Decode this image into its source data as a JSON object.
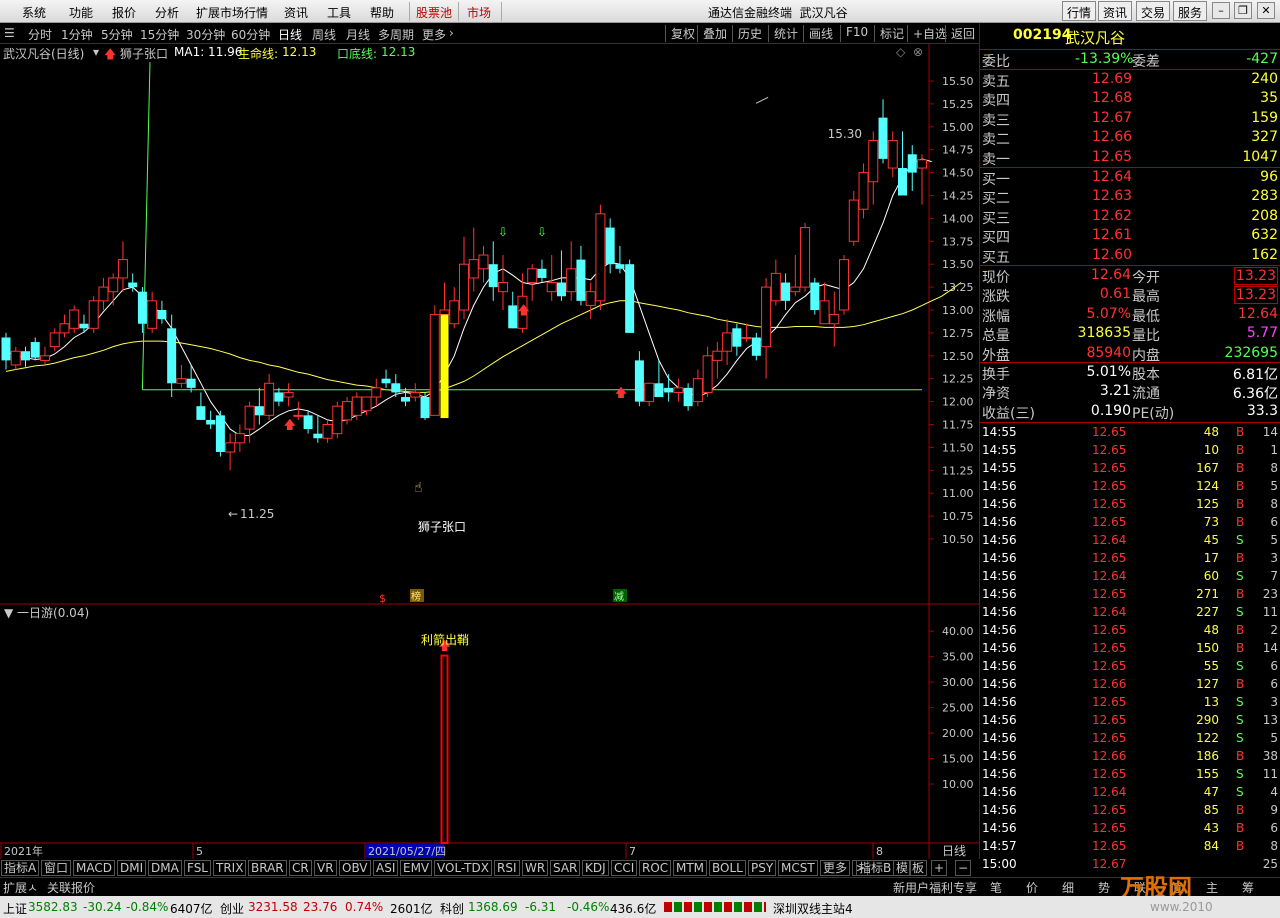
{
  "menu": {
    "items": [
      "系统",
      "功能",
      "报价",
      "分析",
      "扩展市场行情",
      "资讯",
      "工具",
      "帮助"
    ],
    "stock_pool": "股票池",
    "market": "市场",
    "title": "通达信金融终端",
    "stock": "武汉凡谷",
    "right_buttons": [
      "行情",
      "资讯",
      "交易",
      "服务"
    ],
    "window_controls": [
      "minimize-icon",
      "restore-icon",
      "close-icon"
    ]
  },
  "periods": {
    "items": [
      "分时",
      "1分钟",
      "5分钟",
      "15分钟",
      "30分钟",
      "60分钟",
      "日线",
      "周线",
      "月线",
      "多周期",
      "更多"
    ],
    "active": "日线",
    "right": [
      "复权",
      "叠加",
      "历史",
      "统计",
      "画线",
      "F10",
      "标记",
      "+自选",
      "返回"
    ]
  },
  "info": {
    "name": "武汉凡谷(日线)",
    "indicator": "狮子张口",
    "ma1": "MA1: 11.96",
    "life_label": "生命线:",
    "life_value": "12.13",
    "bottom_label": "口底线:",
    "bottom_value": "12.13"
  },
  "chart": {
    "labels": {
      "high": "15.30",
      "low": "11.25",
      "signal": "狮子张口"
    },
    "price_ticks": [
      "15.50",
      "15.25",
      "15.00",
      "14.75",
      "14.50",
      "14.25",
      "14.00",
      "13.75",
      "13.50",
      "13.25",
      "13.00",
      "12.75",
      "12.50",
      "12.25",
      "12.00",
      "11.75",
      "11.50",
      "11.25",
      "11.00",
      "10.75",
      "10.50"
    ],
    "markers": [
      "$",
      "榜",
      "减"
    ],
    "sub_title": "一日游(0.04)",
    "sub_signal": "利箭出鞘",
    "sub_ticks": [
      "40.00",
      "35.00",
      "30.00",
      "25.00",
      "20.00",
      "15.00",
      "10.00"
    ],
    "date_axis": [
      "2021年",
      "5",
      "2021/05/27/四",
      "7",
      "8"
    ],
    "period_tag": "日线",
    "colors": {
      "up": "#ff3232",
      "down": "#54ffff",
      "ma": "#ffffff",
      "life": "#ffff54",
      "bottom": "#54ff54",
      "signal_bar": "#ffff00",
      "sub_bar": "#ff0000"
    }
  },
  "chart_data": {
    "type": "candlestick",
    "title": "",
    "ylim": [
      10.5,
      15.5
    ],
    "sub_ylim": [
      0,
      42
    ],
    "candles": [
      {
        "o": 12.7,
        "h": 12.75,
        "l": 12.35,
        "c": 12.45
      },
      {
        "o": 12.4,
        "h": 12.6,
        "l": 12.35,
        "c": 12.55
      },
      {
        "o": 12.55,
        "h": 12.6,
        "l": 12.38,
        "c": 12.45
      },
      {
        "o": 12.65,
        "h": 12.7,
        "l": 12.45,
        "c": 12.48
      },
      {
        "o": 12.45,
        "h": 12.6,
        "l": 12.4,
        "c": 12.5
      },
      {
        "o": 12.6,
        "h": 12.8,
        "l": 12.55,
        "c": 12.75
      },
      {
        "o": 12.75,
        "h": 12.95,
        "l": 12.7,
        "c": 12.85
      },
      {
        "o": 12.8,
        "h": 13.05,
        "l": 12.75,
        "c": 13.0
      },
      {
        "o": 12.85,
        "h": 12.95,
        "l": 12.75,
        "c": 12.8
      },
      {
        "o": 12.8,
        "h": 13.15,
        "l": 12.75,
        "c": 13.1
      },
      {
        "o": 13.1,
        "h": 13.35,
        "l": 13.0,
        "c": 13.25
      },
      {
        "o": 13.2,
        "h": 13.4,
        "l": 13.05,
        "c": 13.35
      },
      {
        "o": 13.35,
        "h": 13.75,
        "l": 13.2,
        "c": 13.55
      },
      {
        "o": 13.3,
        "h": 13.4,
        "l": 13.2,
        "c": 13.25
      },
      {
        "o": 13.2,
        "h": 13.25,
        "l": 12.75,
        "c": 12.85
      },
      {
        "o": 12.8,
        "h": 13.2,
        "l": 12.75,
        "c": 13.1
      },
      {
        "o": 13.0,
        "h": 13.1,
        "l": 12.85,
        "c": 12.9
      },
      {
        "o": 12.8,
        "h": 12.95,
        "l": 12.05,
        "c": 12.2
      },
      {
        "o": 12.2,
        "h": 12.4,
        "l": 12.15,
        "c": 12.25
      },
      {
        "o": 12.25,
        "h": 12.4,
        "l": 12.1,
        "c": 12.15
      },
      {
        "o": 11.95,
        "h": 12.1,
        "l": 11.8,
        "c": 11.8
      },
      {
        "o": 11.8,
        "h": 11.9,
        "l": 11.7,
        "c": 11.75
      },
      {
        "o": 11.85,
        "h": 11.9,
        "l": 11.4,
        "c": 11.45
      },
      {
        "o": 11.45,
        "h": 11.65,
        "l": 11.25,
        "c": 11.55
      },
      {
        "o": 11.55,
        "h": 11.75,
        "l": 11.45,
        "c": 11.65
      },
      {
        "o": 11.7,
        "h": 12.0,
        "l": 11.55,
        "c": 11.95
      },
      {
        "o": 11.95,
        "h": 12.15,
        "l": 11.75,
        "c": 11.85
      },
      {
        "o": 11.85,
        "h": 12.3,
        "l": 11.8,
        "c": 12.2
      },
      {
        "o": 12.1,
        "h": 12.15,
        "l": 11.95,
        "c": 12.0
      },
      {
        "o": 12.05,
        "h": 12.2,
        "l": 11.95,
        "c": 12.1
      },
      {
        "o": 11.85,
        "h": 12.0,
        "l": 11.8,
        "c": 11.85
      },
      {
        "o": 11.85,
        "h": 11.9,
        "l": 11.65,
        "c": 11.7
      },
      {
        "o": 11.65,
        "h": 11.85,
        "l": 11.55,
        "c": 11.6
      },
      {
        "o": 11.6,
        "h": 11.8,
        "l": 11.55,
        "c": 11.75
      },
      {
        "o": 11.65,
        "h": 12.0,
        "l": 11.6,
        "c": 11.95
      },
      {
        "o": 11.8,
        "h": 12.05,
        "l": 11.75,
        "c": 12.0
      },
      {
        "o": 11.85,
        "h": 12.1,
        "l": 11.8,
        "c": 12.05
      },
      {
        "o": 11.9,
        "h": 12.05,
        "l": 11.85,
        "c": 12.05
      },
      {
        "o": 12.05,
        "h": 12.25,
        "l": 11.95,
        "c": 12.15
      },
      {
        "o": 12.25,
        "h": 12.35,
        "l": 12.15,
        "c": 12.2
      },
      {
        "o": 12.2,
        "h": 12.3,
        "l": 12.05,
        "c": 12.1
      },
      {
        "o": 12.05,
        "h": 12.15,
        "l": 11.95,
        "c": 12.0
      },
      {
        "o": 12.05,
        "h": 12.2,
        "l": 12.0,
        "c": 12.1
      },
      {
        "o": 12.05,
        "h": 12.1,
        "l": 11.8,
        "c": 11.82
      },
      {
        "o": 11.85,
        "h": 13.05,
        "l": 11.85,
        "c": 12.95
      },
      {
        "o": 12.95,
        "h": 13.3,
        "l": 12.75,
        "c": 13.0
      },
      {
        "o": 12.85,
        "h": 13.25,
        "l": 12.8,
        "c": 13.1
      },
      {
        "o": 13.0,
        "h": 13.8,
        "l": 12.9,
        "c": 13.5
      },
      {
        "o": 13.35,
        "h": 13.9,
        "l": 13.2,
        "c": 13.55
      },
      {
        "o": 13.45,
        "h": 13.7,
        "l": 13.3,
        "c": 13.6
      },
      {
        "o": 13.5,
        "h": 13.75,
        "l": 13.1,
        "c": 13.25
      },
      {
        "o": 13.2,
        "h": 13.6,
        "l": 13.0,
        "c": 13.3
      },
      {
        "o": 13.05,
        "h": 13.2,
        "l": 12.8,
        "c": 12.8
      },
      {
        "o": 12.8,
        "h": 13.4,
        "l": 12.75,
        "c": 13.15
      },
      {
        "o": 13.3,
        "h": 13.5,
        "l": 13.1,
        "c": 13.45
      },
      {
        "o": 13.45,
        "h": 13.55,
        "l": 13.3,
        "c": 13.35
      },
      {
        "o": 13.2,
        "h": 13.6,
        "l": 13.1,
        "c": 13.3
      },
      {
        "o": 13.3,
        "h": 13.65,
        "l": 13.1,
        "c": 13.15
      },
      {
        "o": 13.2,
        "h": 13.75,
        "l": 13.1,
        "c": 13.45
      },
      {
        "o": 13.55,
        "h": 13.7,
        "l": 13.05,
        "c": 13.1
      },
      {
        "o": 13.05,
        "h": 13.3,
        "l": 12.9,
        "c": 13.2
      },
      {
        "o": 13.1,
        "h": 14.15,
        "l": 13.0,
        "c": 14.05
      },
      {
        "o": 13.9,
        "h": 14.0,
        "l": 13.4,
        "c": 13.5
      },
      {
        "o": 13.5,
        "h": 13.7,
        "l": 13.4,
        "c": 13.45
      },
      {
        "o": 13.5,
        "h": 13.55,
        "l": 12.85,
        "c": 12.75
      },
      {
        "o": 12.45,
        "h": 12.55,
        "l": 11.95,
        "c": 12.0
      },
      {
        "o": 12.0,
        "h": 12.2,
        "l": 11.95,
        "c": 12.2
      },
      {
        "o": 12.2,
        "h": 12.45,
        "l": 12.05,
        "c": 12.05
      },
      {
        "o": 12.15,
        "h": 12.3,
        "l": 12.0,
        "c": 12.1
      },
      {
        "o": 12.1,
        "h": 12.25,
        "l": 12.0,
        "c": 12.15
      },
      {
        "o": 12.15,
        "h": 12.2,
        "l": 11.9,
        "c": 11.95
      },
      {
        "o": 12.0,
        "h": 12.35,
        "l": 11.95,
        "c": 12.25
      },
      {
        "o": 12.1,
        "h": 12.6,
        "l": 12.05,
        "c": 12.5
      },
      {
        "o": 12.45,
        "h": 12.65,
        "l": 12.25,
        "c": 12.55
      },
      {
        "o": 12.55,
        "h": 12.9,
        "l": 12.4,
        "c": 12.75
      },
      {
        "o": 12.8,
        "h": 12.85,
        "l": 12.5,
        "c": 12.6
      },
      {
        "o": 12.7,
        "h": 12.85,
        "l": 12.65,
        "c": 12.7
      },
      {
        "o": 12.7,
        "h": 12.75,
        "l": 12.45,
        "c": 12.5
      },
      {
        "o": 12.6,
        "h": 13.35,
        "l": 12.25,
        "c": 13.25
      },
      {
        "o": 13.1,
        "h": 13.55,
        "l": 13.05,
        "c": 13.4
      },
      {
        "o": 13.3,
        "h": 13.4,
        "l": 13.0,
        "c": 13.1
      },
      {
        "o": 13.2,
        "h": 13.6,
        "l": 13.15,
        "c": 13.25
      },
      {
        "o": 13.25,
        "h": 13.95,
        "l": 13.2,
        "c": 13.9
      },
      {
        "o": 13.3,
        "h": 13.35,
        "l": 12.95,
        "c": 13.0
      },
      {
        "o": 12.85,
        "h": 13.3,
        "l": 12.85,
        "c": 13.1
      },
      {
        "o": 12.85,
        "h": 13.2,
        "l": 12.6,
        "c": 12.95
      },
      {
        "o": 13.0,
        "h": 13.6,
        "l": 12.95,
        "c": 13.55
      },
      {
        "o": 13.75,
        "h": 14.3,
        "l": 13.7,
        "c": 14.2
      },
      {
        "o": 14.1,
        "h": 14.6,
        "l": 14.0,
        "c": 14.5
      },
      {
        "o": 14.4,
        "h": 14.95,
        "l": 14.15,
        "c": 14.85
      },
      {
        "o": 15.1,
        "h": 15.3,
        "l": 14.6,
        "c": 14.65
      },
      {
        "o": 14.55,
        "h": 14.95,
        "l": 14.45,
        "c": 14.85
      },
      {
        "o": 14.55,
        "h": 14.95,
        "l": 14.3,
        "c": 14.25
      },
      {
        "o": 14.7,
        "h": 14.8,
        "l": 14.3,
        "c": 14.5
      },
      {
        "o": 14.55,
        "h": 14.7,
        "l": 14.15,
        "c": 14.64
      }
    ],
    "ma1": [
      12.55,
      12.5,
      12.48,
      12.46,
      12.47,
      12.52,
      12.6,
      12.7,
      12.76,
      12.85,
      12.98,
      13.1,
      13.22,
      13.25,
      13.15,
      13.05,
      12.95,
      12.8,
      12.6,
      12.4,
      12.2,
      12.0,
      11.85,
      11.7,
      11.63,
      11.63,
      11.7,
      11.78,
      11.85,
      11.9,
      11.92,
      11.9,
      11.85,
      11.8,
      11.78,
      11.8,
      11.85,
      11.9,
      11.95,
      12.02,
      12.08,
      12.1,
      12.08,
      12.05,
      12.12,
      12.3,
      12.5,
      12.8,
      13.05,
      13.25,
      13.4,
      13.45,
      13.38,
      13.3,
      13.28,
      13.3,
      13.32,
      13.35,
      13.35,
      13.35,
      13.33,
      13.45,
      13.52,
      13.5,
      13.35,
      13.05,
      12.75,
      12.45,
      12.25,
      12.15,
      12.1,
      12.05,
      12.1,
      12.18,
      12.3,
      12.45,
      12.58,
      12.65,
      12.7,
      12.8,
      12.95,
      13.08,
      13.15,
      13.25,
      13.28,
      13.25,
      13.22,
      13.3,
      13.45,
      13.7,
      13.95,
      14.25,
      14.45,
      14.6,
      14.65,
      14.62
    ],
    "life": [
      12.33,
      12.35,
      12.37,
      12.39,
      12.4,
      12.42,
      12.45,
      12.48,
      12.5,
      12.53,
      12.56,
      12.6,
      12.63,
      12.65,
      12.66,
      12.66,
      12.66,
      12.65,
      12.64,
      12.62,
      12.6,
      12.58,
      12.55,
      12.52,
      12.48,
      12.45,
      12.43,
      12.4,
      12.38,
      12.35,
      12.32,
      12.3,
      12.27,
      12.24,
      12.22,
      12.2,
      12.18,
      12.17,
      12.15,
      12.13,
      12.12,
      12.11,
      12.1,
      12.1,
      12.11,
      12.14,
      12.18,
      12.22,
      12.28,
      12.35,
      12.42,
      12.49,
      12.55,
      12.61,
      12.67,
      12.73,
      12.79,
      12.85,
      12.9,
      12.95,
      13.0,
      13.05,
      13.08,
      13.1,
      13.1,
      13.08,
      13.06,
      13.04,
      13.02,
      13.0,
      12.97,
      12.95,
      12.93,
      12.9,
      12.88,
      12.86,
      12.84,
      12.82,
      12.81,
      12.81,
      12.81,
      12.82,
      12.82,
      12.82,
      12.81,
      12.81,
      12.81,
      12.82,
      12.84,
      12.87,
      12.9,
      12.93,
      12.96,
      13.0,
      13.05,
      13.1,
      13.15,
      13.22,
      13.3
    ],
    "bottom_line": 12.13,
    "signal_bar": {
      "index": 45,
      "low": 11.82,
      "high": 12.95
    },
    "sub_bar": {
      "index": 45,
      "value": 36
    }
  },
  "quote": {
    "code": "002194",
    "name": "武汉凡谷",
    "weibi_label": "委比",
    "weibi": "-13.39%",
    "weicha_label": "委差",
    "weicha": "-427",
    "asks": [
      {
        "label": "卖五",
        "price": "12.69",
        "vol": "240"
      },
      {
        "label": "卖四",
        "price": "12.68",
        "vol": "35"
      },
      {
        "label": "卖三",
        "price": "12.67",
        "vol": "159"
      },
      {
        "label": "卖二",
        "price": "12.66",
        "vol": "327"
      },
      {
        "label": "卖一",
        "price": "12.65",
        "vol": "1047"
      }
    ],
    "bids": [
      {
        "label": "买一",
        "price": "12.64",
        "vol": "96"
      },
      {
        "label": "买二",
        "price": "12.63",
        "vol": "283"
      },
      {
        "label": "买三",
        "price": "12.62",
        "vol": "208"
      },
      {
        "label": "买四",
        "price": "12.61",
        "vol": "632"
      },
      {
        "label": "买五",
        "price": "12.60",
        "vol": "162"
      }
    ],
    "stats": [
      {
        "l1": "现价",
        "v1": "12.64",
        "l2": "今开",
        "v2": "13.23"
      },
      {
        "l1": "涨跌",
        "v1": "0.61",
        "l2": "最高",
        "v2": "13.23"
      },
      {
        "l1": "涨幅",
        "v1": "5.07%",
        "l2": "最低",
        "v2": "12.64"
      },
      {
        "l1": "总量",
        "v1": "318635",
        "l2": "量比",
        "v2": "5.77"
      },
      {
        "l1": "外盘",
        "v1": "85940",
        "l2": "内盘",
        "v2": "232695"
      }
    ],
    "stats2": [
      {
        "l1": "换手",
        "v1": "5.01%",
        "l2": "股本",
        "v2": "6.81亿"
      },
      {
        "l1": "净资",
        "v1": "3.21",
        "l2": "流通",
        "v2": "6.36亿"
      },
      {
        "l1": "收益(三)",
        "v1": "0.190",
        "l2": "PE(动)",
        "v2": "33.3"
      }
    ],
    "ticks": [
      {
        "t": "14:55",
        "p": "12.65",
        "v": "48",
        "d": "B",
        "n": "14"
      },
      {
        "t": "14:55",
        "p": "12.65",
        "v": "10",
        "d": "B",
        "n": "1"
      },
      {
        "t": "14:55",
        "p": "12.65",
        "v": "167",
        "d": "B",
        "n": "8"
      },
      {
        "t": "14:56",
        "p": "12.65",
        "v": "124",
        "d": "B",
        "n": "5"
      },
      {
        "t": "14:56",
        "p": "12.65",
        "v": "125",
        "d": "B",
        "n": "8"
      },
      {
        "t": "14:56",
        "p": "12.65",
        "v": "73",
        "d": "B",
        "n": "6"
      },
      {
        "t": "14:56",
        "p": "12.64",
        "v": "45",
        "d": "S",
        "n": "5"
      },
      {
        "t": "14:56",
        "p": "12.65",
        "v": "17",
        "d": "B",
        "n": "3"
      },
      {
        "t": "14:56",
        "p": "12.64",
        "v": "60",
        "d": "S",
        "n": "7"
      },
      {
        "t": "14:56",
        "p": "12.65",
        "v": "271",
        "d": "B",
        "n": "23"
      },
      {
        "t": "14:56",
        "p": "12.64",
        "v": "227",
        "d": "S",
        "n": "11"
      },
      {
        "t": "14:56",
        "p": "12.65",
        "v": "48",
        "d": "B",
        "n": "2"
      },
      {
        "t": "14:56",
        "p": "12.65",
        "v": "150",
        "d": "B",
        "n": "14"
      },
      {
        "t": "14:56",
        "p": "12.65",
        "v": "55",
        "d": "S",
        "n": "6"
      },
      {
        "t": "14:56",
        "p": "12.66",
        "v": "127",
        "d": "B",
        "n": "6"
      },
      {
        "t": "14:56",
        "p": "12.65",
        "v": "13",
        "d": "S",
        "n": "3"
      },
      {
        "t": "14:56",
        "p": "12.65",
        "v": "290",
        "d": "S",
        "n": "13"
      },
      {
        "t": "14:56",
        "p": "12.65",
        "v": "122",
        "d": "S",
        "n": "5"
      },
      {
        "t": "14:56",
        "p": "12.66",
        "v": "186",
        "d": "B",
        "n": "38"
      },
      {
        "t": "14:56",
        "p": "12.65",
        "v": "155",
        "d": "S",
        "n": "11"
      },
      {
        "t": "14:56",
        "p": "12.64",
        "v": "47",
        "d": "S",
        "n": "4"
      },
      {
        "t": "14:56",
        "p": "12.65",
        "v": "85",
        "d": "B",
        "n": "9"
      },
      {
        "t": "14:56",
        "p": "12.65",
        "v": "43",
        "d": "B",
        "n": "6"
      },
      {
        "t": "14:57",
        "p": "12.65",
        "v": "84",
        "d": "B",
        "n": "8"
      },
      {
        "t": "15:00",
        "p": "12.67",
        "v": "",
        "d": "",
        "n": "25"
      }
    ]
  },
  "indicator_tabs": [
    "指标A",
    "窗口",
    "MACD",
    "DMI",
    "DMA",
    "FSL",
    "TRIX",
    "BRAR",
    "CR",
    "VR",
    "OBV",
    "ASI",
    "EMV",
    "VOL-TDX",
    "RSI",
    "WR",
    "SAR",
    "KDJ",
    "CCI",
    "ROC",
    "MTM",
    "BOLL",
    "PSY",
    "MCST",
    "更多",
    ">"
  ],
  "indicator_right": [
    "指标B",
    "模",
    "板",
    "+",
    "−"
  ],
  "ext_bar": {
    "left": [
      "扩展ㅅ",
      "关联报价"
    ],
    "promo": "新用户福利专享",
    "tabs": [
      "笔",
      "价",
      "细",
      "势",
      "联",
      "值",
      "主",
      "筹"
    ],
    "watermark": "万股网",
    "watermark_url": "www.2010"
  },
  "status": {
    "sh_label": "上证",
    "sh_val": "3582.83",
    "sh_chg": "-30.24",
    "sh_pct": "-0.84%",
    "sh_amt": "6407亿",
    "cy_label": "创业",
    "cy_val": "3231.58",
    "cy_chg": "23.76",
    "cy_pct": "0.74%",
    "cy_amt": "2601亿",
    "kc_label": "科创",
    "kc_val": "1368.69",
    "kc_chg": "-6.31",
    "kc_pct": "-0.46%",
    "kc_amt": "436.6亿",
    "server": "深圳双线主站4"
  }
}
